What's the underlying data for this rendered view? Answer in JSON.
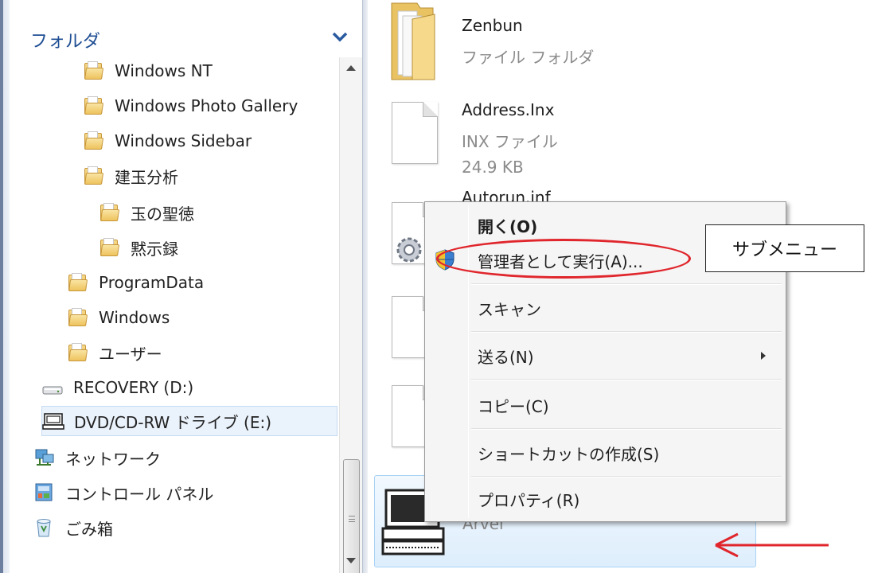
{
  "nav": {
    "header": "フォルダ",
    "items": [
      {
        "label": "Windows NT",
        "icon": "folder-icon"
      },
      {
        "label": "Windows Photo Gallery",
        "icon": "folder-icon"
      },
      {
        "label": "Windows Sidebar",
        "icon": "folder-icon"
      },
      {
        "label": "建玉分析",
        "icon": "folder-icon"
      },
      {
        "label": "玉の聖徳",
        "icon": "folder-icon"
      },
      {
        "label": "黙示録",
        "icon": "folder-icon"
      },
      {
        "label": "ProgramData",
        "icon": "folder-icon"
      },
      {
        "label": "Windows",
        "icon": "folder-icon"
      },
      {
        "label": "ユーザー",
        "icon": "folder-icon"
      },
      {
        "label": "RECOVERY (D:)",
        "icon": "drive-icon"
      },
      {
        "label": "DVD/CD-RW ドライブ (E:)",
        "icon": "dvd-drive-icon"
      },
      {
        "label": "ネットワーク",
        "icon": "network-icon"
      },
      {
        "label": "コントロール パネル",
        "icon": "control-panel-icon"
      },
      {
        "label": "ごみ箱",
        "icon": "recycle-bin-icon"
      }
    ]
  },
  "files": [
    {
      "name": "Zenbun",
      "type": "ファイル フォルダ"
    },
    {
      "name": "Address.Inx",
      "type": "INX ファイル",
      "size": "24.9 KB"
    },
    {
      "name": "Autorun.inf",
      "type": ""
    },
    {
      "name": "Arvel",
      "type": ""
    }
  ],
  "context_menu": {
    "items": [
      {
        "label": "開く(O)"
      },
      {
        "label": "管理者として実行(A)..."
      },
      {
        "label": "スキャン"
      },
      {
        "label": "送る(N)"
      },
      {
        "label": "コピー(C)"
      },
      {
        "label": "ショートカットの作成(S)"
      },
      {
        "label": "プロパティ(R)"
      }
    ]
  },
  "annotation": {
    "callout": "サブメニュー",
    "highlight_color": "#e0262c"
  }
}
